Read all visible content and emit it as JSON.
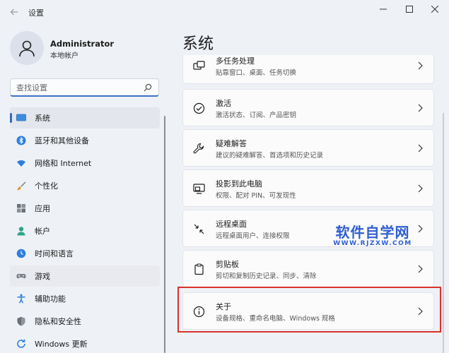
{
  "window": {
    "title": "设置"
  },
  "user": {
    "name": "Administrator",
    "account_type": "本地帐户"
  },
  "search": {
    "placeholder": "查找设置"
  },
  "nav": {
    "items": [
      {
        "label": "系统",
        "icon": "monitor-icon",
        "active": true
      },
      {
        "label": "蓝牙和其他设备",
        "icon": "bluetooth-icon"
      },
      {
        "label": "网络和 Internet",
        "icon": "wifi-icon"
      },
      {
        "label": "个性化",
        "icon": "brush-icon"
      },
      {
        "label": "应用",
        "icon": "apps-icon"
      },
      {
        "label": "帐户",
        "icon": "person-icon"
      },
      {
        "label": "时间和语言",
        "icon": "globe-clock-icon"
      },
      {
        "label": "游戏",
        "icon": "gamepad-icon"
      },
      {
        "label": "辅助功能",
        "icon": "accessibility-icon"
      },
      {
        "label": "隐私和安全性",
        "icon": "shield-icon"
      },
      {
        "label": "Windows 更新",
        "icon": "update-icon"
      }
    ]
  },
  "main": {
    "title": "系统",
    "cards": [
      {
        "title": "多任务处理",
        "desc": "贴靠窗口、桌面、任务切换",
        "icon": "multitask-icon"
      },
      {
        "title": "激活",
        "desc": "激活状态、订阅、产品密钥",
        "icon": "check-circle-icon"
      },
      {
        "title": "疑难解答",
        "desc": "建议的疑难解答、首选项和历史记录",
        "icon": "wrench-icon"
      },
      {
        "title": "投影到此电脑",
        "desc": "权限、配对 PIN、可发现性",
        "icon": "project-icon"
      },
      {
        "title": "远程桌面",
        "desc": "远程桌面用户、连接权限",
        "icon": "remote-icon"
      },
      {
        "title": "剪贴板",
        "desc": "剪切和复制历史记录、同步、清除",
        "icon": "clipboard-icon"
      },
      {
        "title": "关于",
        "desc": "设备规格、重命名电脑、Windows 规格",
        "icon": "info-icon"
      }
    ]
  },
  "watermark": {
    "main": "软件自学网",
    "sub": "WWW.RJZXW.COM"
  },
  "colors": {
    "accent": "#2f6cc1",
    "highlight_border": "#d9322b",
    "watermark": "#2f5fd1"
  }
}
